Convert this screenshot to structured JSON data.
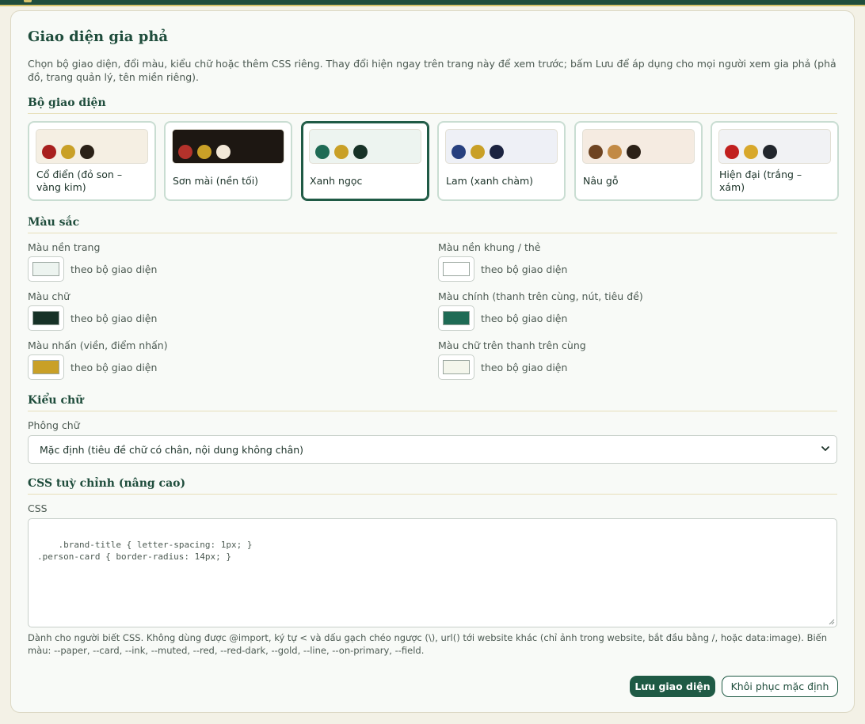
{
  "page": {
    "title": "Giao diện gia phả",
    "intro": "Chọn bộ giao diện, đổi màu, kiểu chữ hoặc thêm CSS riêng. Thay đổi hiện ngay trên trang này để xem trước; bấm Lưu để áp dụng cho mọi người xem gia phả (phả đồ, trang quản lý, tên miền riêng)."
  },
  "sections": {
    "themes": "Bộ giao diện",
    "colors": "Màu sắc",
    "font": "Kiểu chữ",
    "css": "CSS tuỳ chỉnh (nâng cao)"
  },
  "themes": [
    {
      "name": "Cổ điển (đỏ son – vàng kim)",
      "bg": "#f5efe3",
      "dots": [
        "#a8201f",
        "#c9a027",
        "#2a2117"
      ],
      "selected": false
    },
    {
      "name": "Sơn mài (nền tối)",
      "bg": "#1d1712",
      "dots": [
        "#b3322b",
        "#c9a027",
        "#f2e8d8"
      ],
      "selected": false
    },
    {
      "name": "Xanh ngọc",
      "bg": "#edf4f0",
      "dots": [
        "#1f6b55",
        "#c9a027",
        "#173227"
      ],
      "selected": true
    },
    {
      "name": "Lam (xanh chàm)",
      "bg": "#eef0f6",
      "dots": [
        "#27407f",
        "#c9a027",
        "#1b2340"
      ],
      "selected": false
    },
    {
      "name": "Nâu gỗ",
      "bg": "#f5ebe1",
      "dots": [
        "#6e4422",
        "#c28a45",
        "#2c2117"
      ],
      "selected": false
    },
    {
      "name": "Hiện đại (trắng – xám)",
      "bg": "#f1f2f4",
      "dots": [
        "#c1201f",
        "#d8a82b",
        "#22262c"
      ],
      "selected": false
    }
  ],
  "colors": {
    "page_bg": {
      "label": "Màu nền trang",
      "note": "theo bộ giao diện",
      "value": "#edf4f0"
    },
    "card_bg": {
      "label": "Màu nền khung / thẻ",
      "note": "theo bộ giao diện",
      "value": "#ffffff"
    },
    "text": {
      "label": "Màu chữ",
      "note": "theo bộ giao diện",
      "value": "#173227"
    },
    "primary": {
      "label": "Màu chính (thanh trên cùng, nút, tiêu đề)",
      "note": "theo bộ giao diện",
      "value": "#1f6b55"
    },
    "accent": {
      "label": "Màu nhấn (viền, điểm nhấn)",
      "note": "theo bộ giao diện",
      "value": "#c9a027"
    },
    "on_primary": {
      "label": "Màu chữ trên thanh trên cùng",
      "note": "theo bộ giao diện",
      "value": "#f4f6ec"
    }
  },
  "font": {
    "label": "Phông chữ",
    "selected": "Mặc định (tiêu đề chữ có chân, nội dung không chân)"
  },
  "css": {
    "label": "CSS",
    "value": ".brand-title { letter-spacing: 1px; }\n.person-card { border-radius: 14px; }",
    "hint": "Dành cho người biết CSS. Không dùng được @import, ký tự < và dấu gạch chéo ngược (\\), url() tới website khác (chỉ ảnh trong website, bắt đầu bằng /, hoặc data:image). Biến màu: --paper, --card, --ink, --muted, --red, --red-dark, --gold, --line, --on-primary, --field."
  },
  "actions": {
    "save": "Lưu giao diện",
    "reset": "Khôi phục mặc định"
  },
  "icons": {
    "select": "chevron-down-icon",
    "resize": "resize-grip-icon"
  }
}
